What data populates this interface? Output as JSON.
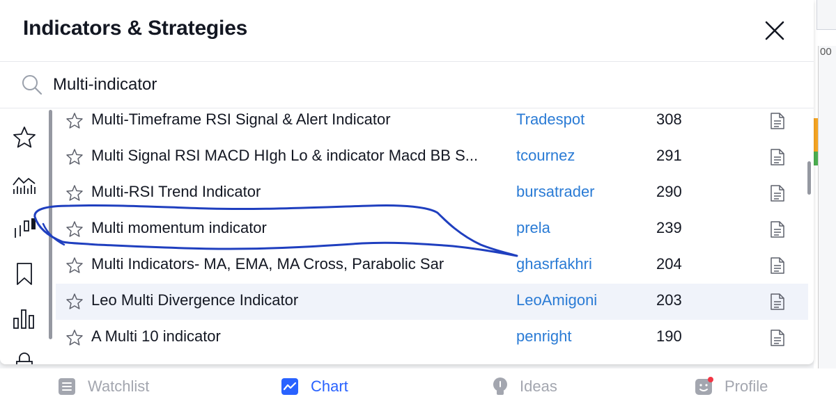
{
  "modal": {
    "title": "Indicators & Strategies",
    "search": {
      "value": "Multi-indicator"
    }
  },
  "sidebar": {
    "icons": [
      "star-icon",
      "line-chart-icon",
      "candlestick-icon",
      "bookmark-icon",
      "bar-chart-icon",
      "lock-icon"
    ]
  },
  "results": [
    {
      "name": "Multi-Timeframe RSI Signal & Alert Indicator",
      "author": "Tradespot",
      "count": "308"
    },
    {
      "name": "Multi Signal RSI MACD HIgh Lo & indicator Macd BB S...",
      "author": "tcournez",
      "count": "291"
    },
    {
      "name": "Multi-RSI Trend Indicator",
      "author": "bursatrader",
      "count": "290"
    },
    {
      "name": "Multi momentum indicator",
      "author": "prela",
      "count": "239"
    },
    {
      "name": "Multi Indicators- MA, EMA, MA Cross, Parabolic Sar",
      "author": "ghasrfakhri",
      "count": "204"
    },
    {
      "name": "Leo Multi Divergence Indicator",
      "author": "LeoAmigoni",
      "count": "203"
    },
    {
      "name": "A Multi 10 indicator",
      "author": "penright",
      "count": "190"
    }
  ],
  "background": {
    "axis_label": "00"
  },
  "bottom_nav": {
    "watchlist": "Watchlist",
    "chart": "Chart",
    "ideas": "Ideas",
    "profile": "Profile"
  },
  "colors": {
    "accent": "#2962ff",
    "author_link": "#2a7bd5",
    "annotation_stroke": "#1f3fbf",
    "row_highlight": "#f0f3fa"
  }
}
